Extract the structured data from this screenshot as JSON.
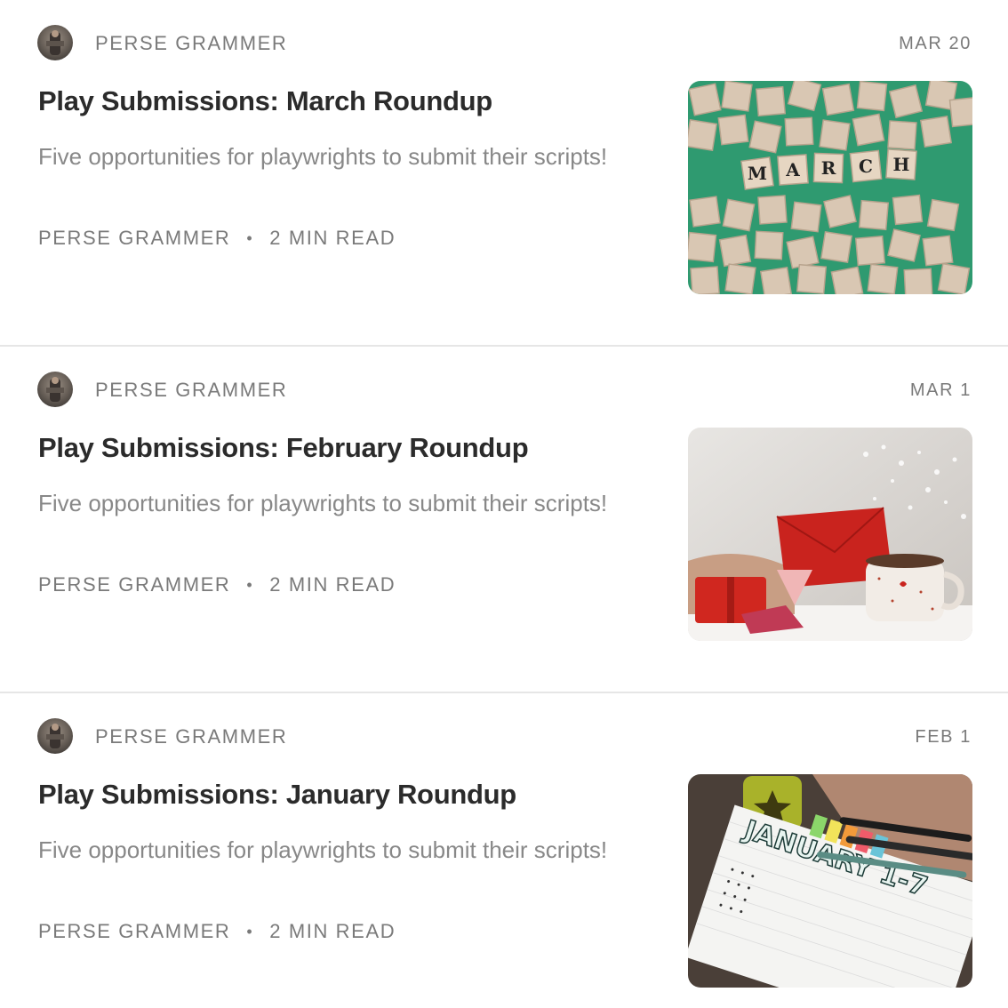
{
  "posts": [
    {
      "author": "PERSE GRAMMER",
      "date": "MAR 20",
      "title": "Play Submissions: March Roundup",
      "excerpt": "Five opportunities for playwrights to submit their scripts!",
      "meta_author": "PERSE GRAMMER",
      "separator": "•",
      "read_time": "2 MIN READ",
      "thumbnail_text": [
        "M",
        "A",
        "R",
        "C",
        "H"
      ]
    },
    {
      "author": "PERSE GRAMMER",
      "date": "MAR 1",
      "title": "Play Submissions: February Roundup",
      "excerpt": "Five opportunities for playwrights to submit their scripts!",
      "meta_author": "PERSE GRAMMER",
      "separator": "•",
      "read_time": "2 MIN READ"
    },
    {
      "author": "PERSE GRAMMER",
      "date": "FEB 1",
      "title": "Play Submissions: January Roundup",
      "excerpt": "Five opportunities for playwrights to submit their scripts!",
      "meta_author": "PERSE GRAMMER",
      "separator": "•",
      "read_time": "2 MIN READ",
      "thumbnail_text": "JANUARY 1-7"
    }
  ],
  "colors": {
    "text_primary": "#2b2b2b",
    "text_secondary": "#888888",
    "text_meta": "#7a7a7a",
    "divider": "#e6e6e6"
  }
}
